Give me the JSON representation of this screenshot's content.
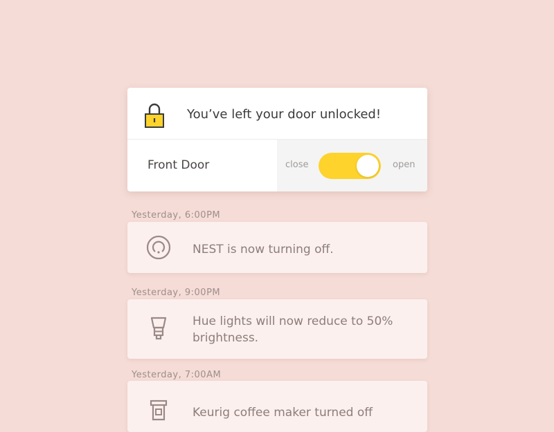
{
  "alert": {
    "title": "You’ve left your door unlocked!",
    "icon": "lock-icon",
    "door_label": "Front Door",
    "toggle": {
      "off_label": "close",
      "on_label": "open",
      "state": "open"
    }
  },
  "feed": [
    {
      "time": "Yesterday, 6:00PM",
      "icon": "nest-thermostat-icon",
      "message": "NEST is now turning off."
    },
    {
      "time": "Yesterday, 9:00PM",
      "icon": "light-bulb-icon",
      "message": "Hue lights will now reduce to 50% brightness."
    },
    {
      "time": "Yesterday, 7:00AM",
      "icon": "coffee-maker-icon",
      "message": "Keurig coffee maker turned off"
    }
  ],
  "colors": {
    "background": "#f5dcd6",
    "accent": "#fdd32c",
    "feed_card": "#fbf0ee",
    "feed_text": "#8d7d7a",
    "icon_stroke": "#9a8986"
  }
}
